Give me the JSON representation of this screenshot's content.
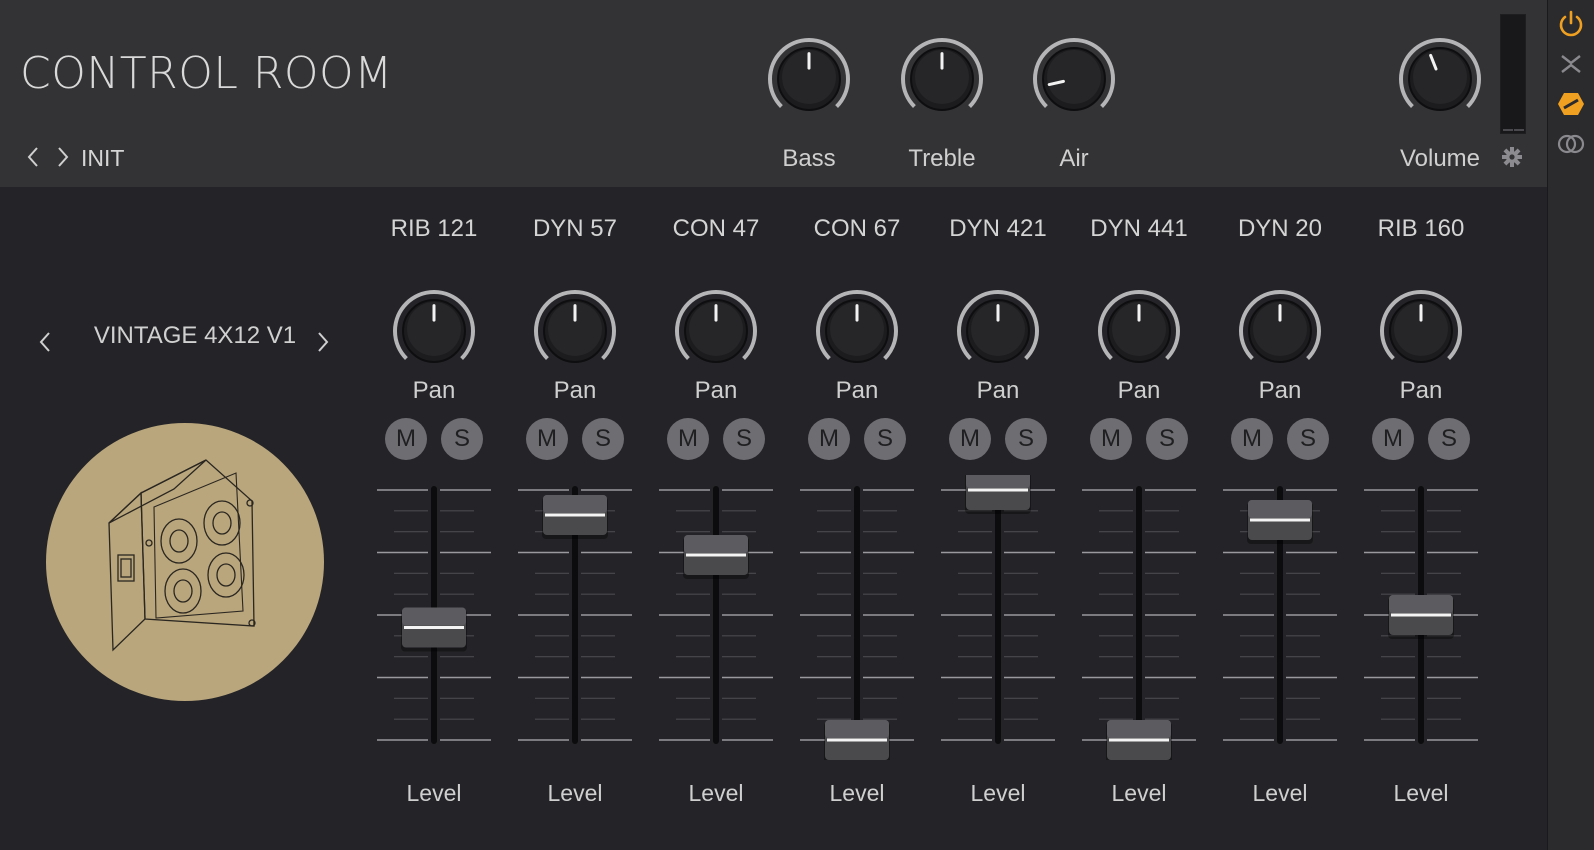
{
  "header": {
    "title": "CONTROL ROOM",
    "preset": "INIT",
    "knobs": [
      {
        "name": "Bass",
        "value": 0.5
      },
      {
        "name": "Treble",
        "value": 0.5
      },
      {
        "name": "Air",
        "value": 0.12
      },
      {
        "name": "Volume",
        "value": 0.42
      }
    ]
  },
  "cabinet": {
    "name": "VINTAGE 4X12 V1"
  },
  "channels": [
    {
      "name": "RIB 121",
      "pan_label": "Pan",
      "pan": 0.5,
      "mute": "M",
      "solo": "S",
      "level_label": "Level",
      "level": 0.45
    },
    {
      "name": "DYN 57",
      "pan_label": "Pan",
      "pan": 0.5,
      "mute": "M",
      "solo": "S",
      "level_label": "Level",
      "level": 0.9
    },
    {
      "name": "CON 47",
      "pan_label": "Pan",
      "pan": 0.5,
      "mute": "M",
      "solo": "S",
      "level_label": "Level",
      "level": 0.74
    },
    {
      "name": "CON 67",
      "pan_label": "Pan",
      "pan": 0.5,
      "mute": "M",
      "solo": "S",
      "level_label": "Level",
      "level": 0.0
    },
    {
      "name": "DYN 421",
      "pan_label": "Pan",
      "pan": 0.5,
      "mute": "M",
      "solo": "S",
      "level_label": "Level",
      "level": 1.0
    },
    {
      "name": "DYN 441",
      "pan_label": "Pan",
      "pan": 0.5,
      "mute": "M",
      "solo": "S",
      "level_label": "Level",
      "level": 0.0
    },
    {
      "name": "DYN 20",
      "pan_label": "Pan",
      "pan": 0.5,
      "mute": "M",
      "solo": "S",
      "level_label": "Level",
      "level": 0.88
    },
    {
      "name": "RIB 160",
      "pan_label": "Pan",
      "pan": 0.5,
      "mute": "M",
      "solo": "S",
      "level_label": "Level",
      "level": 0.5
    }
  ],
  "sidebar": {
    "icons": [
      "power-icon",
      "collapse-icon",
      "bypass-hex-icon",
      "link-rings-icon"
    ],
    "accent": "#f0a020"
  },
  "colors": {
    "background": "#242428",
    "header": "#333335",
    "cabinet_circle": "#b9a67c",
    "accent": "#f0a020"
  }
}
